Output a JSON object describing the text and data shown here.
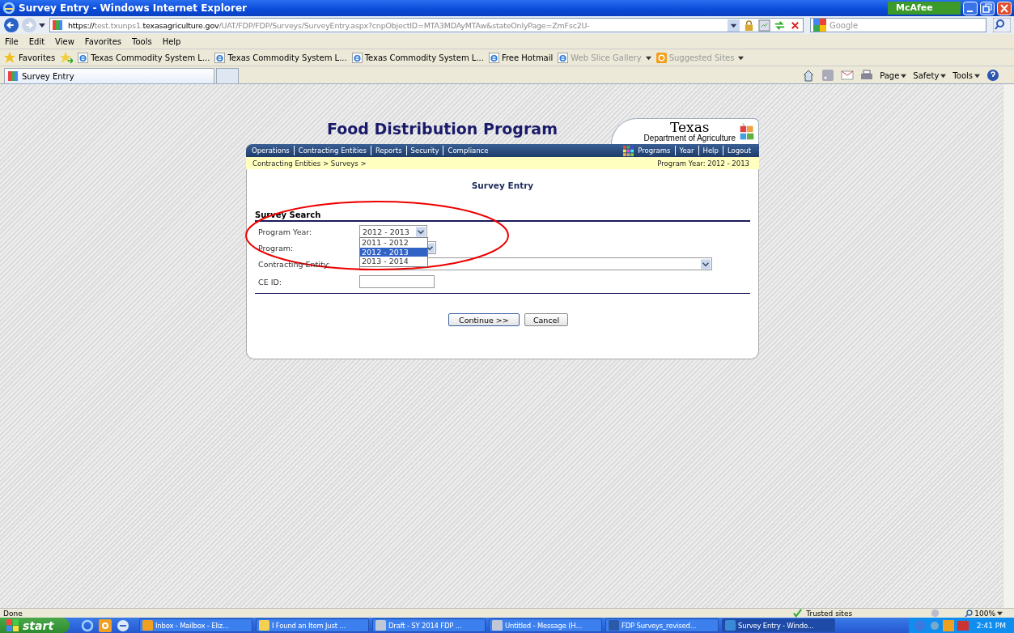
{
  "window": {
    "title": "Survey Entry - Windows Internet Explorer",
    "addon": "McAfee"
  },
  "address_bar": {
    "url": [
      {
        "text": "https://",
        "emphasis": true
      },
      {
        "text": "test.txunps1.",
        "emphasis": false
      },
      {
        "text": "texasagriculture.gov",
        "emphasis": true
      },
      {
        "text": "/UAT/FDP/FDP/Surveys/SurveyEntry.aspx?cnpObjectID=MTA3MDAyMTAw&stateOnlyPage=ZmFsc2U-",
        "emphasis": false
      }
    ],
    "search_placeholder": "Google"
  },
  "menu_bar": [
    "File",
    "Edit",
    "View",
    "Favorites",
    "Tools",
    "Help"
  ],
  "favorites_bar": {
    "label": "Favorites",
    "items": [
      {
        "label": "Texas Commodity System  L...",
        "dimmed": false,
        "has_menu": false,
        "kind": "ie"
      },
      {
        "label": "Texas Commodity System  L...",
        "dimmed": false,
        "has_menu": false,
        "kind": "ie"
      },
      {
        "label": "Texas Commodity System  L...",
        "dimmed": false,
        "has_menu": false,
        "kind": "ie"
      },
      {
        "label": "Free Hotmail",
        "dimmed": false,
        "has_menu": false,
        "kind": "ie"
      },
      {
        "label": "Web Slice Gallery",
        "dimmed": true,
        "has_menu": true,
        "kind": "ie"
      },
      {
        "label": "Suggested Sites",
        "dimmed": true,
        "has_menu": true,
        "kind": "suggested"
      }
    ]
  },
  "tabs": [
    {
      "label": "Survey Entry",
      "selected": true
    }
  ],
  "command_bar": [
    "Page",
    "Safety",
    "Tools"
  ],
  "page": {
    "title": "Food Distribution Program",
    "logo": {
      "name": "Texas",
      "subtitle": "Department of Agriculture"
    },
    "nav_left": [
      "Operations",
      "Contracting Entities",
      "Reports",
      "Security",
      "Compliance"
    ],
    "nav_right": [
      "Programs",
      "Year",
      "Help",
      "Logout"
    ],
    "breadcrumb": "Contracting Entities > Surveys >",
    "program_year": "Program Year: 2012 - 2013",
    "heading": "Survey Entry",
    "section": "Survey Search",
    "fields": [
      {
        "label": "Program Year:",
        "kind": "select",
        "value": "2012 - 2013"
      },
      {
        "label": "Program:",
        "kind": "select"
      },
      {
        "label": "Contracting Entity:",
        "kind": "select"
      },
      {
        "label": "CE ID:",
        "kind": "text"
      }
    ],
    "open_dropdown": [
      {
        "label": "2011 - 2012",
        "selected": false
      },
      {
        "label": "2012 - 2013",
        "selected": true
      },
      {
        "label": "2013 - 2014",
        "selected": false
      }
    ],
    "buttons": [
      "Continue >>",
      "Cancel"
    ]
  },
  "status_bar": {
    "status": "Done",
    "zone": "Trusted sites",
    "zoom": "100%"
  },
  "taskbar": {
    "start": "start",
    "items": [
      {
        "label": "Inbox - Mailbox - Eliz...",
        "kind": "outlook",
        "selected": false
      },
      {
        "label": "I Found an Item Just ...",
        "kind": "mail",
        "selected": false
      },
      {
        "label": "Draft - SY 2014 FDP ...",
        "kind": "draft",
        "selected": false
      },
      {
        "label": "Untitled - Message (H...",
        "kind": "draft",
        "selected": false
      },
      {
        "label": "FDP Surveys_revised...",
        "kind": "word",
        "selected": false
      },
      {
        "label": "Survey Entry - Windo...",
        "kind": "ie",
        "selected": true
      }
    ],
    "clock": "2:41 PM"
  }
}
